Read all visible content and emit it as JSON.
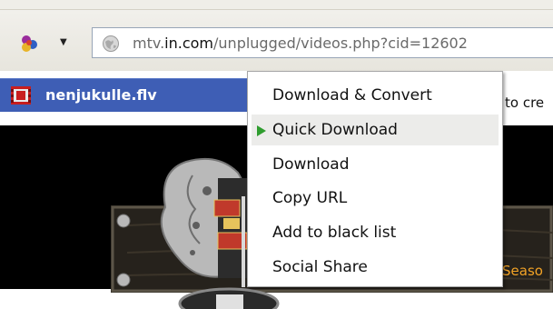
{
  "browser": {
    "url_prefix": "mtv.",
    "url_domain": "in.com",
    "url_path": "/unplugged/videos.php?cid=12602",
    "addon_menu_arrow": "▼"
  },
  "flv_bar": {
    "filename": "nenjukulle.flv"
  },
  "page": {
    "peek_text": "to cre",
    "season_text": "Seaso"
  },
  "context_menu": {
    "items": [
      {
        "label": "Download & Convert",
        "active": false
      },
      {
        "label": "Quick Download",
        "active": true
      },
      {
        "label": "Download",
        "active": false
      },
      {
        "label": "Copy URL",
        "active": false
      },
      {
        "label": "Add to black list",
        "active": false
      },
      {
        "label": "Social Share",
        "active": false
      }
    ]
  },
  "colors": {
    "flv_bar": "#3e5eb5",
    "active_arrow": "#2f9d2f",
    "season_text": "#f2a326"
  }
}
